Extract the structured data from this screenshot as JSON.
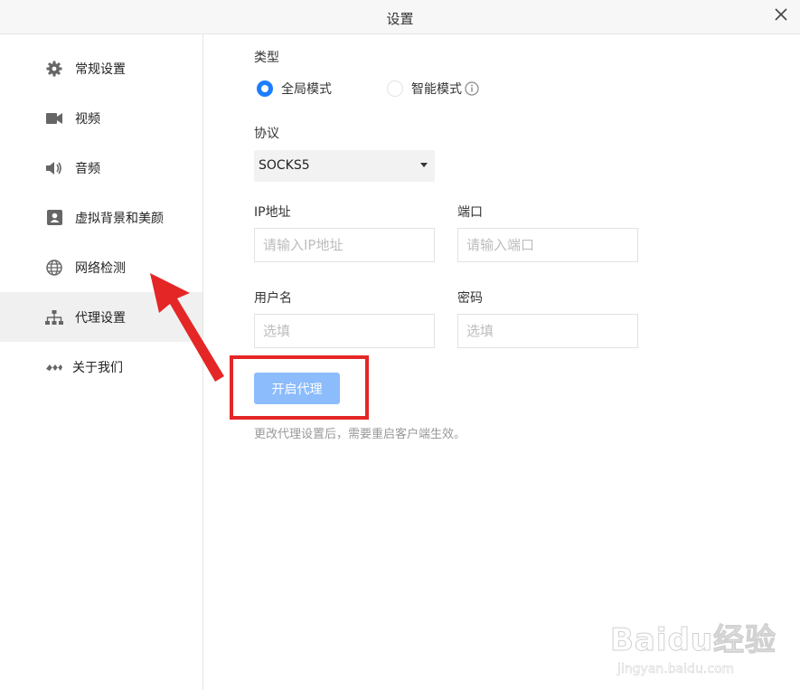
{
  "window": {
    "title": "设置"
  },
  "sidebar": {
    "items": [
      {
        "label": "常规设置",
        "icon": "gear-icon"
      },
      {
        "label": "视频",
        "icon": "video-camera-icon"
      },
      {
        "label": "音频",
        "icon": "speaker-icon"
      },
      {
        "label": "虚拟背景和美颜",
        "icon": "portrait-icon"
      },
      {
        "label": "网络检测",
        "icon": "globe-icon"
      },
      {
        "label": "代理设置",
        "icon": "network-tree-icon",
        "active": true
      },
      {
        "label": "关于我们",
        "icon": "brand-logo-icon"
      }
    ]
  },
  "form": {
    "type_label": "类型",
    "mode_global": "全局模式",
    "mode_smart": "智能模式",
    "selected_mode": "全局模式",
    "protocol_label": "协议",
    "protocol_value": "SOCKS5",
    "ip_label": "IP地址",
    "ip_placeholder": "请输入IP地址",
    "port_label": "端口",
    "port_placeholder": "请输入端口",
    "username_label": "用户名",
    "username_placeholder": "选填",
    "password_label": "密码",
    "password_placeholder": "选填",
    "enable_button": "开启代理",
    "hint": "更改代理设置后，需要重启客户端生效。"
  },
  "annotation": {
    "arrow_color": "#e42626",
    "box_color": "#e42626"
  },
  "watermark": {
    "text": "Baidu经验",
    "sub": "jingyan.baidu.com"
  },
  "colors": {
    "accent": "#1e7dff",
    "button_bg": "#8cbcfc"
  }
}
